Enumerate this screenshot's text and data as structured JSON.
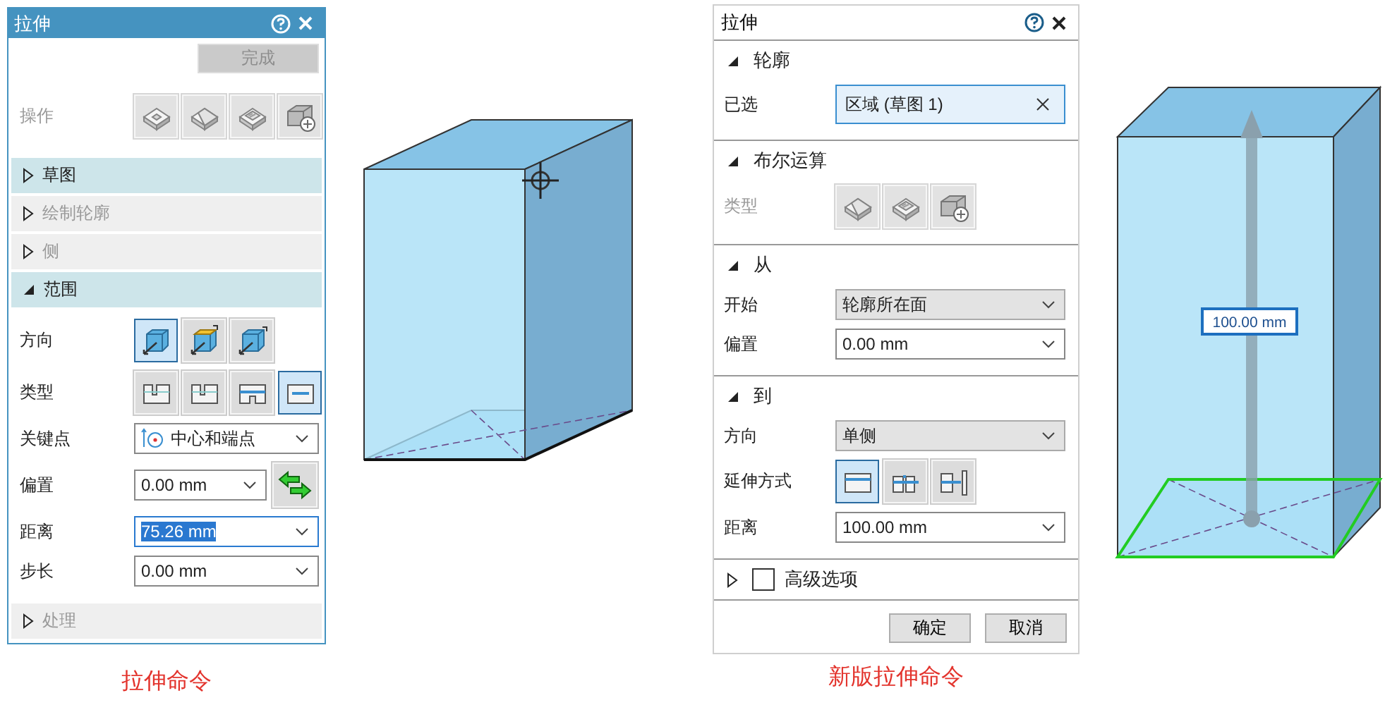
{
  "panels": [
    {
      "kind": "classic",
      "dialog": {
        "title": "拉伸",
        "finish_button": {
          "label": "完成",
          "disabled": true
        },
        "rows": [
          {
            "kind": "operation-icons",
            "label": "操作",
            "disabled": true,
            "buttons": [
              {
                "selected": false
              },
              {
                "selected": false
              },
              {
                "selected": false
              },
              {
                "selected": false
              }
            ]
          }
        ],
        "sections": [
          {
            "title": "草图",
            "expanded": false,
            "disabled": false
          },
          {
            "title": "绘制轮廓",
            "expanded": false,
            "disabled": true
          },
          {
            "title": "侧",
            "expanded": false,
            "disabled": true
          },
          {
            "title": "范围",
            "expanded": true,
            "disabled": false,
            "rows": [
              {
                "kind": "direction-icons",
                "label": "方向",
                "disabled": false,
                "buttons": [
                  {
                    "selected": true
                  },
                  {
                    "selected": false
                  },
                  {
                    "selected": false
                  }
                ]
              },
              {
                "kind": "type-icons",
                "label": "类型",
                "disabled": false,
                "buttons": [
                  {
                    "selected": false
                  },
                  {
                    "selected": false
                  },
                  {
                    "selected": false
                  },
                  {
                    "selected": true
                  }
                ]
              },
              {
                "kind": "point-dropdown",
                "label": "关键点",
                "value": "中心和端点"
              },
              {
                "kind": "dropdown-swap",
                "label": "偏置",
                "value": "0.00 mm"
              },
              {
                "kind": "dropdown",
                "label": "距离",
                "value": "75.26 mm",
                "focused": true
              },
              {
                "kind": "dropdown",
                "label": "步长",
                "value": "0.00 mm",
                "focused": false
              }
            ]
          },
          {
            "title": "处理",
            "expanded": false,
            "disabled": true
          }
        ]
      },
      "viewport": {
        "kind": "cursor"
      },
      "caption": "拉伸命令"
    },
    {
      "kind": "modern",
      "dialog": {
        "title": "拉伸",
        "sections": [
          {
            "title": "轮廓",
            "expanded": true,
            "rows": [
              {
                "kind": "selection",
                "label": "已选",
                "value": "区域 (草图 1)"
              }
            ]
          },
          {
            "title": "布尔运算",
            "expanded": true,
            "rows": [
              {
                "kind": "boolean-icons",
                "label": "类型",
                "disabled": true,
                "buttons": [
                  {
                    "selected": false
                  },
                  {
                    "selected": false
                  },
                  {
                    "selected": false
                  }
                ]
              }
            ]
          },
          {
            "title": "从",
            "expanded": true,
            "rows": [
              {
                "kind": "combo",
                "label": "开始",
                "value": "轮廓所在面"
              },
              {
                "kind": "dropdown",
                "label": "偏置",
                "value": "0.00 mm",
                "focused": false
              }
            ]
          },
          {
            "title": "到",
            "expanded": true,
            "rows": [
              {
                "kind": "combo",
                "label": "方向",
                "value": "单侧"
              },
              {
                "kind": "extent-icons",
                "label": "延伸方式",
                "disabled": false,
                "buttons": [
                  {
                    "selected": true
                  },
                  {
                    "selected": false
                  },
                  {
                    "selected": false
                  }
                ]
              },
              {
                "kind": "dropdown",
                "label": "距离",
                "value": "100.00 mm",
                "focused": false
              }
            ]
          },
          {
            "title": "高级选项",
            "expanded": false,
            "checkbox": {
              "checked": false
            }
          }
        ],
        "buttons": [
          "确定",
          "取消"
        ]
      },
      "viewport": {
        "kind": "dimension",
        "dimension": "100.00 mm"
      },
      "caption": "新版拉伸命令"
    }
  ]
}
